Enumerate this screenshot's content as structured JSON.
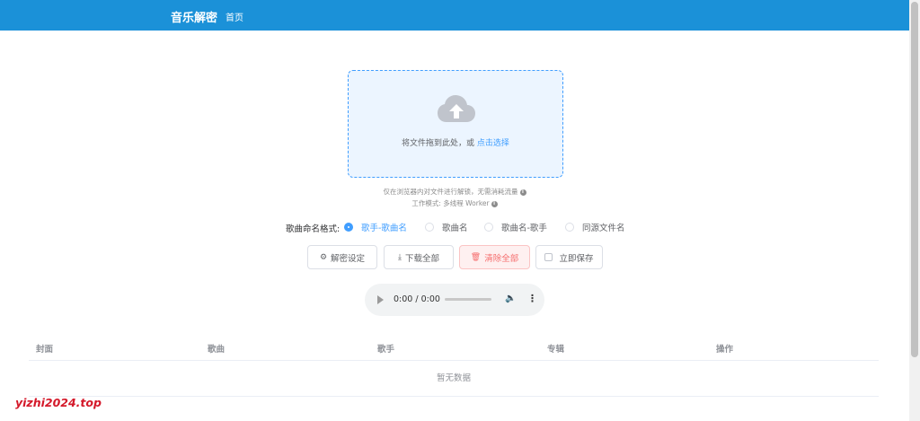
{
  "header": {
    "brand": "音乐解密",
    "nav_home": "首页",
    "color": "#1b91d8"
  },
  "upload": {
    "icon": "cloud-upload-icon",
    "text_prefix": "将文件拖到此处，或 ",
    "text_link": "点击选择"
  },
  "tips": {
    "line1": "仅在浏览器内对文件进行解锁，无需消耗流量",
    "line2": "工作模式: 多线程 Worker"
  },
  "naming": {
    "label": "歌曲命名格式:",
    "options": [
      "歌手-歌曲名",
      "歌曲名",
      "歌曲名-歌手",
      "同源文件名"
    ],
    "selected": "歌手-歌曲名"
  },
  "buttons": {
    "settings": "解密设定",
    "download_all": "下载全部",
    "clear_all": "清除全部",
    "save_now": "立即保存"
  },
  "audio": {
    "time": "0:00 / 0:00"
  },
  "table": {
    "columns": [
      "封面",
      "歌曲",
      "歌手",
      "专辑",
      "操作"
    ],
    "empty_text": "暂无数据"
  },
  "watermark": "yizhi2024.top",
  "accent": "#409eff",
  "danger": "#f56c6c"
}
